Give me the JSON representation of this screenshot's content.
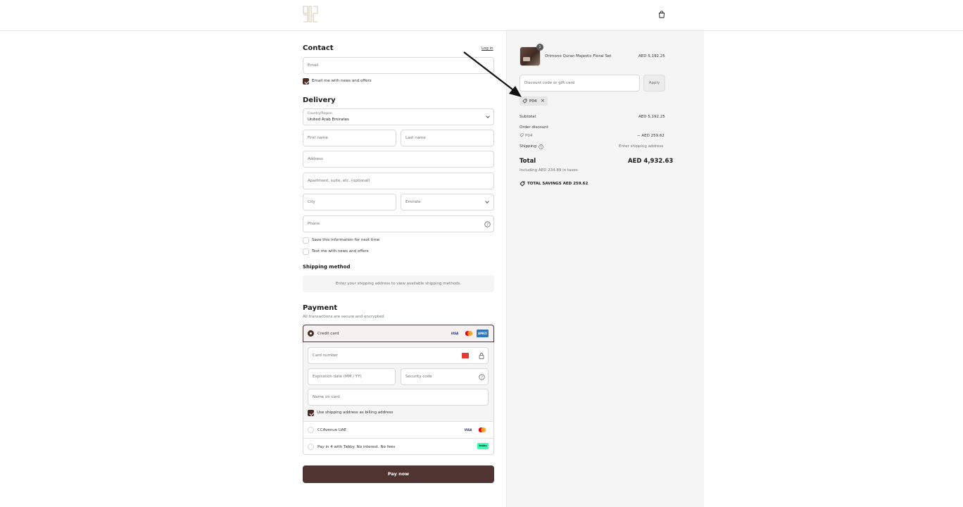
{
  "header": {
    "logo": "gold-outline-logo",
    "cart_icon": "bag-icon"
  },
  "contact": {
    "title": "Contact",
    "login_link": "Log in",
    "email_placeholder": "Email",
    "newsletter_label": "Email me with news and offers",
    "newsletter_checked": true
  },
  "delivery": {
    "title": "Delivery",
    "country_label": "Country/Region",
    "country_value": "United Arab Emirates",
    "first_name_placeholder": "First name",
    "last_name_placeholder": "Last name",
    "address_placeholder": "Address",
    "apartment_placeholder": "Apartment, suite, etc. (optional)",
    "city_placeholder": "City",
    "emirate_placeholder": "Emirate",
    "phone_placeholder": "Phone",
    "save_info_label": "Save this information for next time",
    "text_me_label": "Text me with news and offers"
  },
  "shipping_method": {
    "title": "Shipping method",
    "notice": "Enter your shipping address to view available shipping methods."
  },
  "payment": {
    "title": "Payment",
    "subtitle": "All transactions are secure and encrypted.",
    "credit_card_label": "Credit card",
    "card_number_placeholder": "Card number",
    "expiry_placeholder": "Expiration date (MM / YY)",
    "security_code_placeholder": "Security code",
    "name_on_card_placeholder": "Name on card",
    "billing_same_label": "Use shipping address as billing address",
    "ccavenue_label": "CCAvenue UAE",
    "tabby_label": "Pay in 4 with Tabby. No interest. No fees",
    "visa": "VISA",
    "amex": "AMEX",
    "tabby_badge": "tabby",
    "pay_button": "Pay now"
  },
  "summary": {
    "item_name": "Orimono Quran Majestic Floral Set",
    "item_price": "AED 5,192.25",
    "item_qty": "1",
    "discount_placeholder": "Discount code or gift card",
    "apply_button": "Apply",
    "applied_code": "P04",
    "subtotal_label": "Subtotal",
    "subtotal_value": "AED 5,192.25",
    "order_discount_label": "Order discount",
    "discount_code": "P04",
    "discount_value": "− AED 259.62",
    "shipping_label": "Shipping",
    "shipping_value": "Enter shipping address",
    "total_label": "Total",
    "total_value": "AED 4,932.63",
    "taxes_note": "Including AED 234.89 in taxes",
    "savings_label": "TOTAL SAVINGS",
    "savings_value": "AED 259.62"
  },
  "colors": {
    "brand": "#4f3431",
    "summary_bg": "#f5f5f5",
    "border": "#d9d9d9"
  }
}
